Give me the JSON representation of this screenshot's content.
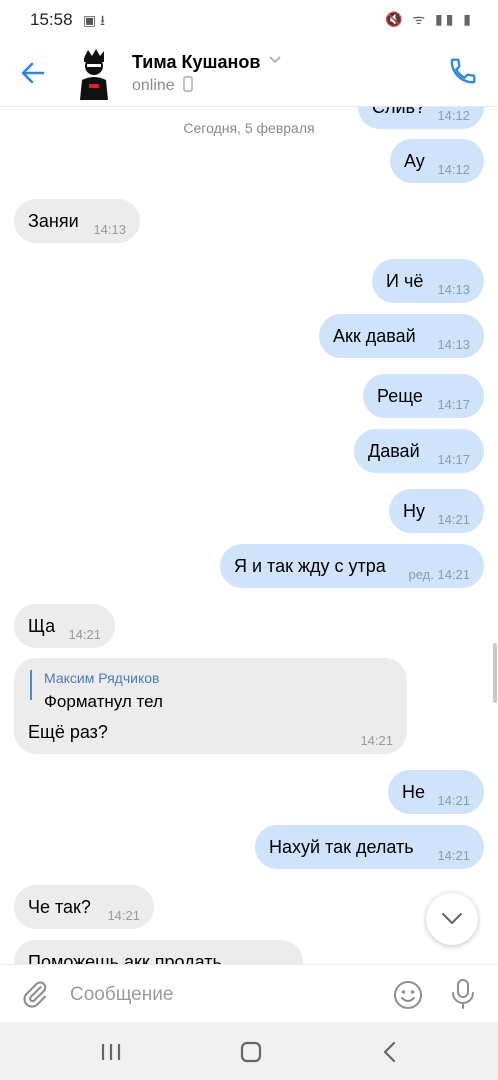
{
  "status_bar": {
    "time": "15:58",
    "left_icons": "▣ ⭳",
    "right_icons": "🔇 ᯤ ▮▮ ▮"
  },
  "header": {
    "contact_name": "Тима Кушанов",
    "status": "online",
    "status_device_icon": "phone-icon"
  },
  "chat": {
    "date_separator": "Сегодня, 5 февраля",
    "top_partial": {
      "text": "Слив?",
      "time": "14:12"
    },
    "messages": [
      {
        "dir": "out",
        "text": "Ау",
        "time": "14:12"
      },
      {
        "dir": "in",
        "text": "Заняи",
        "time": "14:13"
      },
      {
        "dir": "out",
        "text": "И чё",
        "time": "14:13"
      },
      {
        "dir": "out",
        "text": "Акк давай",
        "time": "14:13"
      },
      {
        "dir": "out",
        "text": "Реще",
        "time": "14:17"
      },
      {
        "dir": "out",
        "text": "Давай",
        "time": "14:17"
      },
      {
        "dir": "out",
        "text": "Ну",
        "time": "14:21"
      },
      {
        "dir": "out",
        "text": "Я и так жду с утра",
        "time": "ред. 14:21"
      },
      {
        "dir": "in",
        "text": "Ща",
        "time": "14:21"
      },
      {
        "dir": "out",
        "text": "Не",
        "time": "14:21"
      },
      {
        "dir": "out",
        "text": "Нахуй так делать",
        "time": "14:21"
      },
      {
        "dir": "in",
        "text": "Че так?",
        "time": "14:21"
      },
      {
        "dir": "in",
        "text": "Поможешь акк продать",
        "time": ""
      }
    ],
    "reply_message": {
      "quoted_author": "Максим Рядчиков",
      "quoted_text": "Форматнул тел",
      "text": "Ещё раз?",
      "time": "14:21"
    }
  },
  "input": {
    "placeholder": "Сообщение"
  },
  "colors": {
    "accent": "#2a86e6",
    "outgoing_bubble": "#cfe3fb",
    "incoming_bubble": "#ececec"
  }
}
